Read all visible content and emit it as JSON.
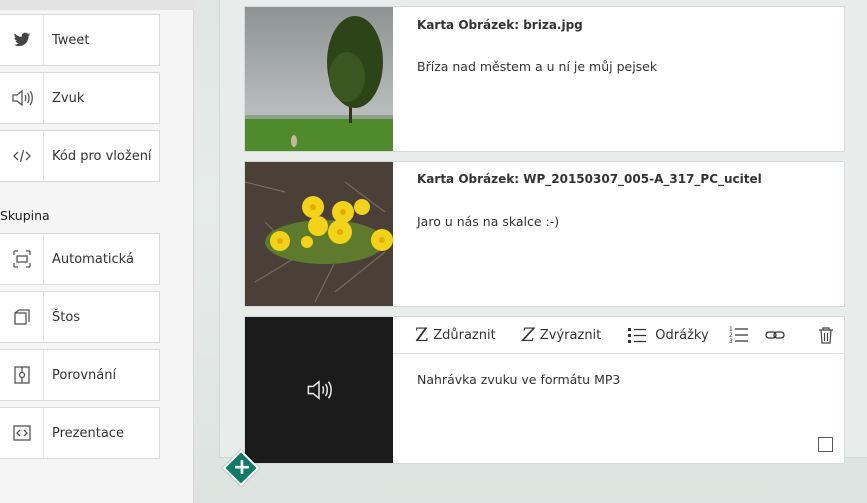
{
  "sidebar": {
    "items": [
      {
        "label": "Tweet",
        "icon": "twitter-icon"
      },
      {
        "label": "Zvuk",
        "icon": "speaker-icon"
      },
      {
        "label": "Kód pro vložení",
        "icon": "code-icon"
      }
    ],
    "group_label": "Skupina",
    "group_items": [
      {
        "label": "Automatická",
        "icon": "auto-layout-icon"
      },
      {
        "label": "Štos",
        "icon": "stack-icon"
      },
      {
        "label": "Porovnání",
        "icon": "compare-icon"
      },
      {
        "label": "Prezentace",
        "icon": "presentation-icon"
      }
    ]
  },
  "cards": [
    {
      "title": "Karta Obrázek: briza.jpg",
      "text": "Bříza nad městem a u ní je můj pejsek",
      "image": "birch-tree-landscape"
    },
    {
      "title": "Karta Obrázek: WP_20150307_005-A_317_PC_ucitel",
      "text": "Jaro u nás na skalce :-)",
      "image": "yellow-flowers"
    },
    {
      "text": "Nahrávka zvuku ve formátu MP3",
      "media": "audio"
    }
  ],
  "toolbar": {
    "emphasize": "Zdůraznit",
    "highlight": "Zvýraznit",
    "bullets": "Odrážky"
  },
  "colors": {
    "accent": "#0f7a66",
    "audio_bg": "#1b1b1b"
  }
}
